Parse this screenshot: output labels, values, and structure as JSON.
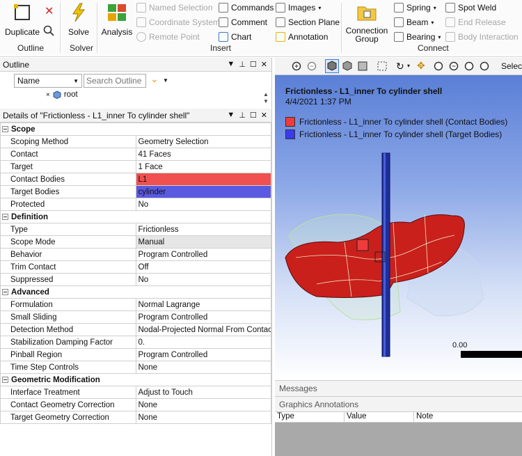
{
  "ribbon": {
    "duplicate": "Duplicate",
    "solve": "Solve",
    "analysis": "Analysis",
    "named_selection": "Named Selection",
    "coordinate_system": "Coordinate System",
    "remote_point": "Remote Point",
    "commands": "Commands",
    "comment": "Comment",
    "chart": "Chart",
    "images": "Images",
    "section_plane": "Section Plane",
    "annotation": "Annotation",
    "connection_group": "Connection Group",
    "spring": "Spring",
    "beam": "Beam",
    "bearing": "Bearing",
    "spot_weld": "Spot Weld",
    "end_release": "End Release",
    "body_interaction": "Body Interaction",
    "groups": {
      "outline": "Outline",
      "solver": "Solver",
      "insert": "Insert",
      "connect": "Connect"
    }
  },
  "outline": {
    "title": "Outline",
    "name_select": "Name",
    "search_placeholder": "Search Outline",
    "tree_item": "root"
  },
  "details": {
    "title": "Details of \"Frictionless - L1_inner To cylinder shell\"",
    "sections": [
      {
        "name": "Scope",
        "rows": [
          {
            "k": "Scoping Method",
            "v": "Geometry Selection"
          },
          {
            "k": "Contact",
            "v": "41 Faces"
          },
          {
            "k": "Target",
            "v": "1 Face"
          },
          {
            "k": "Contact Bodies",
            "v": "L1"
          },
          {
            "k": "Target Bodies",
            "v": "cylinder"
          },
          {
            "k": "Protected",
            "v": "No"
          }
        ]
      },
      {
        "name": "Definition",
        "rows": [
          {
            "k": "Type",
            "v": "Frictionless"
          },
          {
            "k": "Scope Mode",
            "v": "Manual"
          },
          {
            "k": "Behavior",
            "v": "Program Controlled"
          },
          {
            "k": "Trim Contact",
            "v": "Off"
          },
          {
            "k": "Suppressed",
            "v": "No"
          }
        ]
      },
      {
        "name": "Advanced",
        "rows": [
          {
            "k": "Formulation",
            "v": "Normal Lagrange"
          },
          {
            "k": "Small Sliding",
            "v": "Program Controlled"
          },
          {
            "k": "Detection Method",
            "v": "Nodal-Projected Normal From Contact"
          },
          {
            "k": "Stabilization Damping Factor",
            "v": "0."
          },
          {
            "k": "Pinball Region",
            "v": "Program Controlled"
          },
          {
            "k": "Time Step Controls",
            "v": "None"
          }
        ]
      },
      {
        "name": "Geometric Modification",
        "rows": [
          {
            "k": "Interface Treatment",
            "v": "Adjust to Touch"
          },
          {
            "k": "Contact Geometry Correction",
            "v": "None"
          },
          {
            "k": "Target Geometry Correction",
            "v": "None"
          }
        ]
      }
    ]
  },
  "graphics": {
    "select_label": "Select",
    "title": "Frictionless - L1_inner To cylinder shell",
    "date": "4/4/2021 1:37 PM",
    "legend": [
      {
        "label": "Frictionless - L1_inner To cylinder shell (Contact Bodies)",
        "color": "#ee3b3b"
      },
      {
        "label": "Frictionless - L1_inner To cylinder shell (Target Bodies)",
        "color": "#3b3bee"
      }
    ],
    "scale_label": "0.00"
  },
  "messages": {
    "title": "Messages"
  },
  "annotations": {
    "title": "Graphics Annotations",
    "columns": [
      "Type",
      "Value",
      "Note"
    ]
  },
  "colors": {
    "contact_red": "#f05050",
    "target_blue": "#5a5ae0",
    "gold": "#e6b400"
  }
}
